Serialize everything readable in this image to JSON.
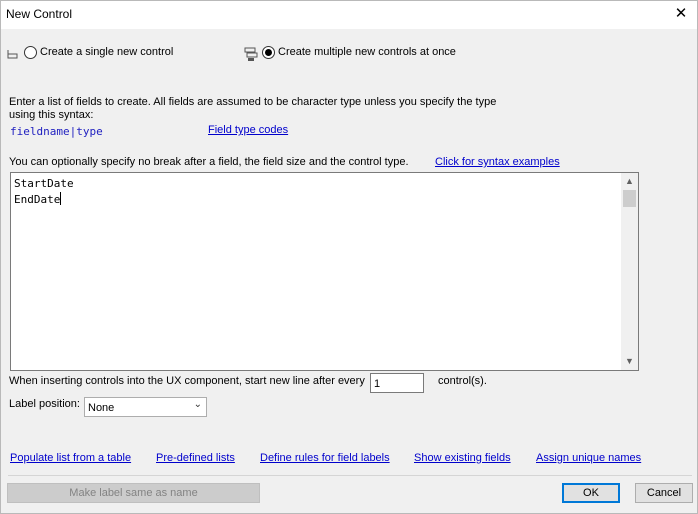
{
  "window": {
    "title": "New Control",
    "close_glyph": "✕"
  },
  "mode": {
    "single_label": "Create a single new control",
    "multiple_label": "Create multiple new controls at once",
    "selected": "multiple"
  },
  "instructions": {
    "line1": "Enter a list of fields to create. All fields are assumed to be character type unless you specify the type",
    "line2": "using this syntax:",
    "syntax": "fieldname|type",
    "field_type_codes_link": "Field type codes",
    "optional_text": "You can optionally specify no break after a field, the field size and the control type.",
    "syntax_examples_link": "Click for syntax examples"
  },
  "fields_text": {
    "lines": [
      "StartDate",
      "EndDate"
    ]
  },
  "line_break": {
    "prefix": "When inserting controls into the UX component, start new line after every",
    "value": "1",
    "suffix": "control(s)."
  },
  "label_position": {
    "label": "Label position:",
    "selected": "None"
  },
  "bottom_links": {
    "populate": "Populate list from a table",
    "predefined": "Pre-defined lists",
    "define_rules": "Define rules for field labels",
    "show_existing": "Show existing fields",
    "assign_unique": "Assign unique names"
  },
  "buttons": {
    "make_label": "Make label same as name",
    "ok": "OK",
    "cancel": "Cancel"
  },
  "icons": {
    "single": "single-control-icon",
    "multiple": "multiple-controls-icon",
    "close": "close-icon",
    "scroll_up": "chevron-up-icon",
    "scroll_down": "chevron-down-icon",
    "dropdown": "chevron-down-icon"
  },
  "colors": {
    "link": "#0000cc",
    "accent": "#0078d7"
  }
}
